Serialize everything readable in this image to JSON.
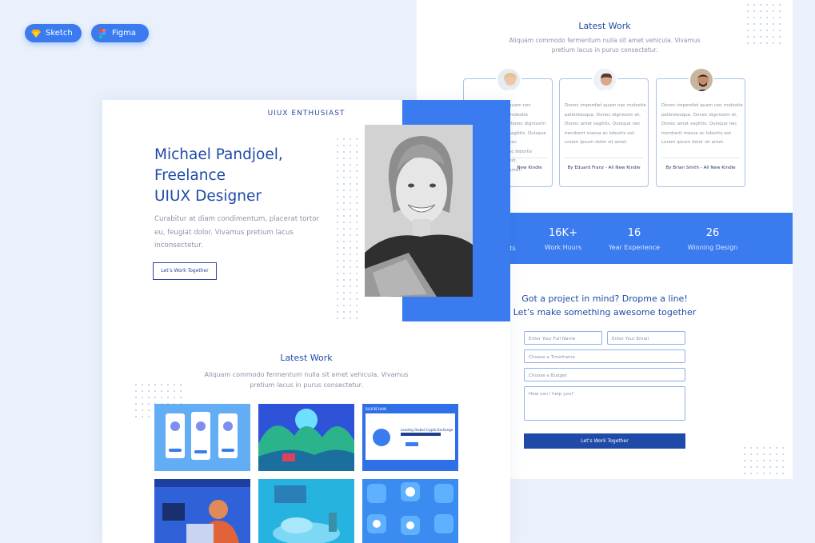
{
  "badges": {
    "sketch": "Sketch",
    "figma": "Figma"
  },
  "back_page": {
    "section_title": "Latest Work",
    "section_subtitle": "Aliquam commodo fermentum nulla sit amet vehicula. Vivamus pretium lacus in purus consectetur.",
    "testimonials": [
      {
        "text": "Donec imperdiet quam nec molestie pellentesque. Donec dignissim et. Donec amet sagittis. Quisque nec hendrerit massa ac lobortis est. Lorem ipsum dolor sit amet.",
        "by": "By ... - All New Kindle",
        "visible_text": "quam nec molestie\nDonec dignissim\nsagittis. Quisque nec\nac lobortis\nest.\namet.",
        "visible_by": "New Kindle"
      },
      {
        "text": "Donec imperdiet quam nec molestie pellentesque. Donec dignissim et. Donec amet sagittis. Quisque nec hendrerit massa ac lobortis est. Lorem ipsum dolor sit amet.",
        "by": "By Eduard Franz - All New Kindle"
      },
      {
        "text": "Donec imperdiet quam nec molestie pellentesque. Donec dignissim et. Donec amet sagittis. Quisque nec hendrerit massa ac lobortis est. Lorem ipsum dolor sit amet.",
        "by": "By Brian Smith - All New Kindle"
      }
    ],
    "stats": [
      {
        "number": "",
        "label": "ts"
      },
      {
        "number": "16K+",
        "label": "Work Hours"
      },
      {
        "number": "16",
        "label": "Year Experience"
      },
      {
        "number": "26",
        "label": "Winning Design"
      }
    ],
    "cta_line1": "Got a project in mind? Dropme a line!",
    "cta_line2": "Let’s make something awesome together",
    "form": {
      "name_placeholder": "Enter Your Full Name",
      "email_placeholder": "Enter Your Email",
      "timeframe_placeholder": "Choose a Timeframe",
      "budget_placeholder": "Choose a Budget",
      "message_placeholder": "How can i help you?",
      "submit_label": "Let’s Work Together"
    }
  },
  "front_page": {
    "tag": "UIUX ENTHUSIAST",
    "hero_line1": "Michael Pandjoel,",
    "hero_line2": "Freelance",
    "hero_line3": "UIUX Designer",
    "description": "Curabitur at diam condimentum, placerat tortor eu, feugiat dolor. Vivamus pretium lacus inconsectetur.",
    "button_label": "Let’s Work Together",
    "section_title": "Latest Work",
    "section_subtitle": "Aliquam commodo fermentum nulla sit amet vehicula. Vivamus pretium lacus in purus consectetur.",
    "thumb_label": "BLOCKCHAIN",
    "thumb_headline": "Leading Global Crypto Exchange"
  },
  "colors": {
    "accent": "#3a7cf0",
    "dark_accent": "#1f4aa8",
    "background": "#eaf1fc"
  }
}
